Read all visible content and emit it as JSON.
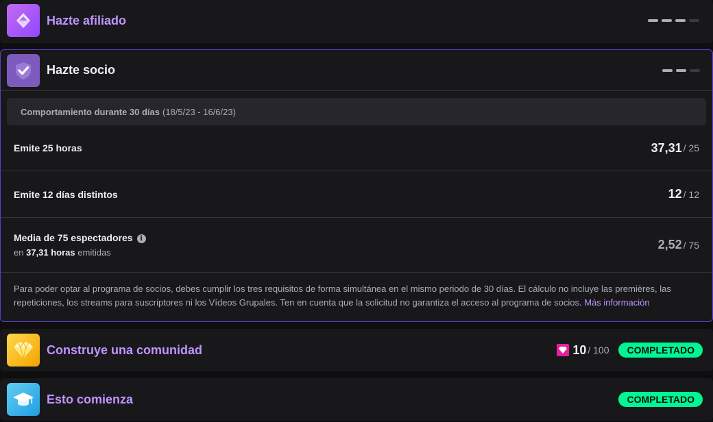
{
  "affiliate": {
    "title": "Hazte afiliado",
    "badge_icon": "affiliate-gem-icon",
    "progress_steps_done": 3,
    "progress_steps_total": 4
  },
  "partner": {
    "title": "Hazte socio",
    "badge_icon": "partner-check-icon",
    "progress_steps_done": 2,
    "progress_steps_total": 3,
    "period_label": "Comportamiento durante 30 días",
    "period_range": "(18/5/23 - 16/6/23)",
    "requirements": [
      {
        "label": "Emite 25 horas",
        "value": "37,31",
        "target": "/ 25"
      },
      {
        "label": "Emite 12 días distintos",
        "value": "12",
        "target": "/ 12"
      },
      {
        "label": "Media de 75 espectadores",
        "sub_prefix": "en",
        "sub_bold": "37,31 horas",
        "sub_suffix": "emitidas",
        "value": "2,52",
        "target": "/ 75"
      }
    ],
    "note": "Para poder optar al programa de socios, debes cumplir los tres requisitos de forma simultánea en el mismo periodo de 30 días. El cálculo no incluye las premières, las repeticiones, los streams para suscriptores ni los Vídeos Grupales. Ten en cuenta que la solicitud no garantiza el acceso al programa de socios.",
    "note_link": "Más información"
  },
  "community": {
    "title": "Construye una comunidad",
    "badge_icon": "diamond-icon",
    "value": "10",
    "target": "/ 100",
    "status": "COMPLETADO"
  },
  "start": {
    "title": "Esto comienza",
    "badge_icon": "graduation-cap-icon",
    "status": "COMPLETADO"
  },
  "colors": {
    "accent": "#bf94ff",
    "completed": "#00f593",
    "partner_border": "#5c3fc4"
  }
}
